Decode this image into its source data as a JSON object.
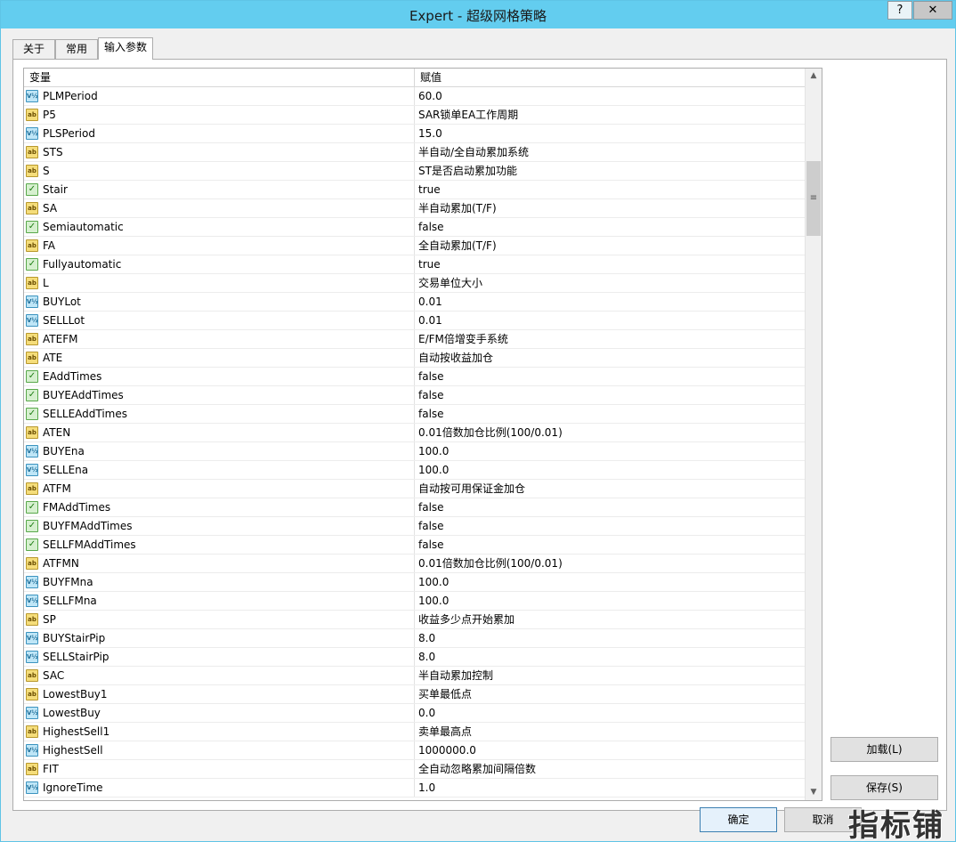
{
  "window": {
    "title": "Expert - 超级网格策略",
    "help_label": "?",
    "close_label": "✕"
  },
  "tabs": [
    {
      "label": "关于",
      "active": false
    },
    {
      "label": "常用",
      "active": false
    },
    {
      "label": "输入参数",
      "active": true
    }
  ],
  "grid": {
    "headers": {
      "variable": "变量",
      "value": "赋值"
    },
    "rows": [
      {
        "type": "va",
        "name": "PLMPeriod",
        "value": "60.0"
      },
      {
        "type": "ab",
        "name": "P5",
        "value": "SAR锁单EA工作周期"
      },
      {
        "type": "va",
        "name": "PLSPeriod",
        "value": "15.0"
      },
      {
        "type": "ab",
        "name": "STS",
        "value": "半自动/全自动累加系统"
      },
      {
        "type": "ab",
        "name": "S",
        "value": "ST是否启动累加功能"
      },
      {
        "type": "bool",
        "name": "Stair",
        "value": "true"
      },
      {
        "type": "ab",
        "name": "SA",
        "value": "半自动累加(T/F)"
      },
      {
        "type": "bool",
        "name": "Semiautomatic",
        "value": "false"
      },
      {
        "type": "ab",
        "name": "FA",
        "value": "全自动累加(T/F)"
      },
      {
        "type": "bool",
        "name": "Fullyautomatic",
        "value": "true"
      },
      {
        "type": "ab",
        "name": "L",
        "value": "交易单位大小"
      },
      {
        "type": "va",
        "name": "BUYLot",
        "value": "0.01"
      },
      {
        "type": "va",
        "name": "SELLLot",
        "value": "0.01"
      },
      {
        "type": "ab",
        "name": "ATEFM",
        "value": "E/FM倍增变手系统"
      },
      {
        "type": "ab",
        "name": "ATE",
        "value": "自动按收益加仓"
      },
      {
        "type": "bool",
        "name": "EAddTimes",
        "value": "false"
      },
      {
        "type": "bool",
        "name": "BUYEAddTimes",
        "value": "false"
      },
      {
        "type": "bool",
        "name": "SELLEAddTimes",
        "value": "false"
      },
      {
        "type": "ab",
        "name": "ATEN",
        "value": "0.01倍数加仓比例(100/0.01)"
      },
      {
        "type": "va",
        "name": "BUYEna",
        "value": "100.0"
      },
      {
        "type": "va",
        "name": "SELLEna",
        "value": "100.0"
      },
      {
        "type": "ab",
        "name": "ATFM",
        "value": "自动按可用保证金加仓"
      },
      {
        "type": "bool",
        "name": "FMAddTimes",
        "value": "false"
      },
      {
        "type": "bool",
        "name": "BUYFMAddTimes",
        "value": "false"
      },
      {
        "type": "bool",
        "name": "SELLFMAddTimes",
        "value": "false"
      },
      {
        "type": "ab",
        "name": "ATFMN",
        "value": "0.01倍数加仓比例(100/0.01)"
      },
      {
        "type": "va",
        "name": "BUYFMna",
        "value": "100.0"
      },
      {
        "type": "va",
        "name": "SELLFMna",
        "value": "100.0"
      },
      {
        "type": "ab",
        "name": "SP",
        "value": "收益多少点开始累加"
      },
      {
        "type": "va",
        "name": "BUYStairPip",
        "value": "8.0"
      },
      {
        "type": "va",
        "name": "SELLStairPip",
        "value": "8.0"
      },
      {
        "type": "ab",
        "name": "SAC",
        "value": "半自动累加控制"
      },
      {
        "type": "ab",
        "name": "LowestBuy1",
        "value": "买单最低点"
      },
      {
        "type": "va",
        "name": "LowestBuy",
        "value": "0.0"
      },
      {
        "type": "ab",
        "name": "HighestSell1",
        "value": "卖单最高点"
      },
      {
        "type": "va",
        "name": "HighestSell",
        "value": "1000000.0"
      },
      {
        "type": "ab",
        "name": "FIT",
        "value": "全自动忽略累加间隔倍数"
      },
      {
        "type": "va",
        "name": "IgnoreTime",
        "value": "1.0"
      }
    ]
  },
  "icons": {
    "ab": "ab",
    "va": "V½",
    "bool": "✓"
  },
  "scrollbar": {
    "up": "▲",
    "down": "▼",
    "grip": "≡"
  },
  "buttons": {
    "load": "加载(L)",
    "save": "保存(S)",
    "ok": "确定",
    "cancel": "取消"
  },
  "watermark": "指标铺"
}
